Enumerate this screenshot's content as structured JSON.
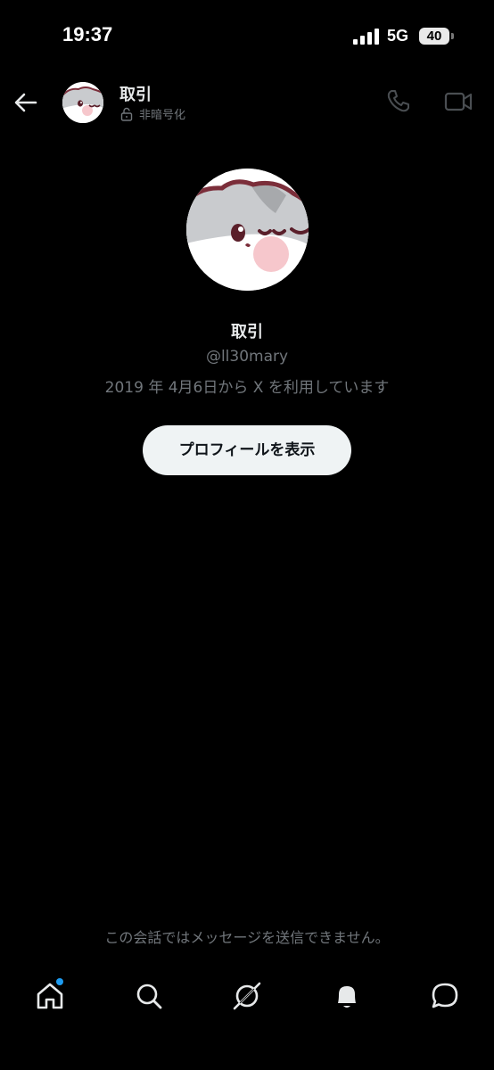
{
  "status_bar": {
    "time": "19:37",
    "network": "5G",
    "battery": "40"
  },
  "header": {
    "title": "取引",
    "encryption_status": "非暗号化"
  },
  "profile": {
    "name": "取引",
    "handle": "@ll30mary",
    "joined": "2019 年 4月6日から X を利用しています",
    "view_profile_label": "プロフィールを表示"
  },
  "notice": {
    "cannot_send": "この会話ではメッセージを送信できません。"
  },
  "colors": {
    "background": "#000000",
    "primary_text": "#e7e9ea",
    "secondary_text": "#71767b",
    "button_bg": "#eff3f4",
    "accent": "#1d9bf0"
  },
  "icons": {
    "back": "arrow-left-icon",
    "lock": "lock-open-icon",
    "call": "phone-icon",
    "video": "video-camera-icon",
    "nav": [
      "home-icon",
      "search-icon",
      "grok-icon",
      "bell-icon",
      "messages-icon"
    ]
  },
  "nav": {
    "home_has_notification": true
  }
}
